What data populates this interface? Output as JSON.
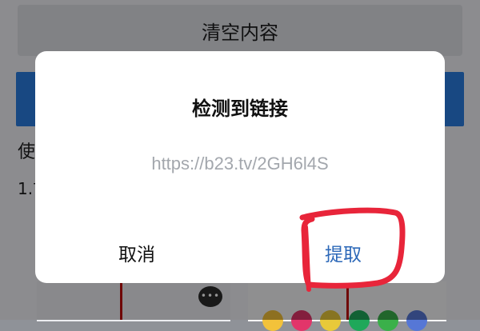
{
  "background_screen": {
    "clear_button_label": "清空内容",
    "text_line_1": "使",
    "text_line_2": "1.首",
    "chat_bubble": "•••"
  },
  "dialog": {
    "title": "检测到链接",
    "link": "https://b23.tv/2GH6l4S",
    "cancel_label": "取消",
    "extract_label": "提取"
  },
  "colors": {
    "accent_blue": "#2a7de1",
    "extract_text": "#2c68b8",
    "annotation_red": "#e8253a"
  },
  "color_dots": [
    "#f3c23a",
    "#e2356a",
    "#e8c93a",
    "#1fa85a",
    "#3ab04a",
    "#5677d6"
  ]
}
